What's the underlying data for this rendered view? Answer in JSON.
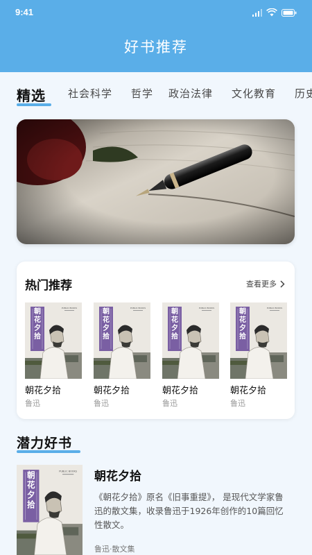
{
  "status_bar": {
    "time": "9:41"
  },
  "header": {
    "title": "好书推荐"
  },
  "tabs": [
    {
      "label": "精选"
    },
    {
      "label": "社会科学"
    },
    {
      "label": "哲学"
    },
    {
      "label": "政治法律"
    },
    {
      "label": "文化教育"
    },
    {
      "label": "历史"
    }
  ],
  "hot": {
    "title": "热门推荐",
    "more_label": "查看更多",
    "books": [
      {
        "title": "朝花夕拾",
        "author": "鲁迅"
      },
      {
        "title": "朝花夕拾",
        "author": "鲁迅"
      },
      {
        "title": "朝花夕拾",
        "author": "鲁迅"
      },
      {
        "title": "朝花夕拾",
        "author": "鲁迅"
      }
    ]
  },
  "cover_text": {
    "title": "朝花夕拾",
    "publisher": "PUBLIC BOOKS"
  },
  "potential": {
    "title": "潜力好书",
    "book": {
      "title": "朝花夕拾",
      "description": "《朝花夕拾》原名《旧事重提》， 是现代文学家鲁迅的散文集，收录鲁迅于1926年创作的10篇回忆性散文。",
      "meta": "鲁迅·散文集"
    }
  },
  "colors": {
    "accent": "#5aaee8",
    "cover_band": "#7a5fa3"
  }
}
